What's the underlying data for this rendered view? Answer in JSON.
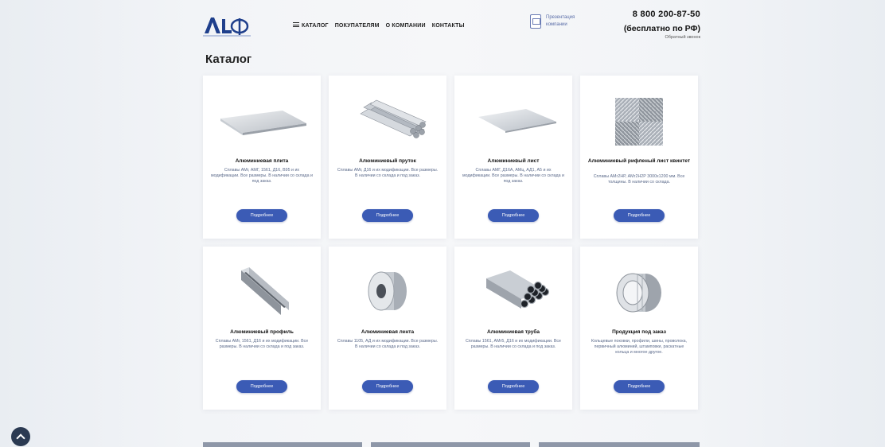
{
  "header": {
    "logo_text": "ALbФA",
    "nav": [
      "КАТАЛОГ",
      "ПОКУПАТЕЛЯМ",
      "О КОМПАНИИ",
      "КОНТАКТЫ"
    ],
    "presentation_label": "Презентация компании",
    "phone": "8 800 200-87-50",
    "phone_note": "(бесплатно по РФ)",
    "callback": "Обратный звонок"
  },
  "page_title": "Каталог",
  "cards": [
    {
      "title": "Алюминиевая плита",
      "desc": "Сплавы АМг, АМГ, 1561, Д16, В95 и их модификации. Все размеры. В наличии со склада и под заказ.",
      "button": "Подробнее",
      "image": "plate-icon"
    },
    {
      "title": "Алюминиевый пруток",
      "desc": "Сплавы АМг, Д16 и их модификации. Все размеры. В наличии со склада и под заказ.",
      "button": "Подробнее",
      "image": "rod-icon"
    },
    {
      "title": "Алюминиевый лист",
      "desc": "Сплавы АМГ, Д16А, АМц, АД1, А5 и их модификации. Все размеры. В наличии со склада и под заказ.",
      "button": "Подробнее",
      "image": "sheet-icon"
    },
    {
      "title": "Алюминиевый рифленый лист квинтет",
      "desc": "Сплавы АМг2НР, АМг2Н2Р 3000х1200 мм. Все толщины. В наличии со склада.",
      "button": "Подробнее",
      "image": "checker-plate-icon"
    },
    {
      "title": "Алюминиевый профиль",
      "desc": "Сплавы АМг, 1561, Д16 и их модификации. Все размеры. В наличии со склада и под заказ.",
      "button": "Подробнее",
      "image": "profile-icon"
    },
    {
      "title": "Алюминиевая лента",
      "desc": "Сплавы 1105, АД и их модификации. Все размеры. В наличии со склада и под заказ.",
      "button": "Подробнее",
      "image": "coil-icon"
    },
    {
      "title": "Алюминиевая труба",
      "desc": "Сплавы 1561, АМг5, Д16 и их модификации. Все размеры. В наличии со склада и под заказ.",
      "button": "Подробнее",
      "image": "pipe-icon"
    },
    {
      "title": "Продукция под заказ",
      "desc": "Кольцевые поковки, профили, шины, проволока, первичный алюминий, штамповки, раскатные кольца и многое другое.",
      "button": "Подробнее",
      "image": "rings-icon"
    }
  ]
}
